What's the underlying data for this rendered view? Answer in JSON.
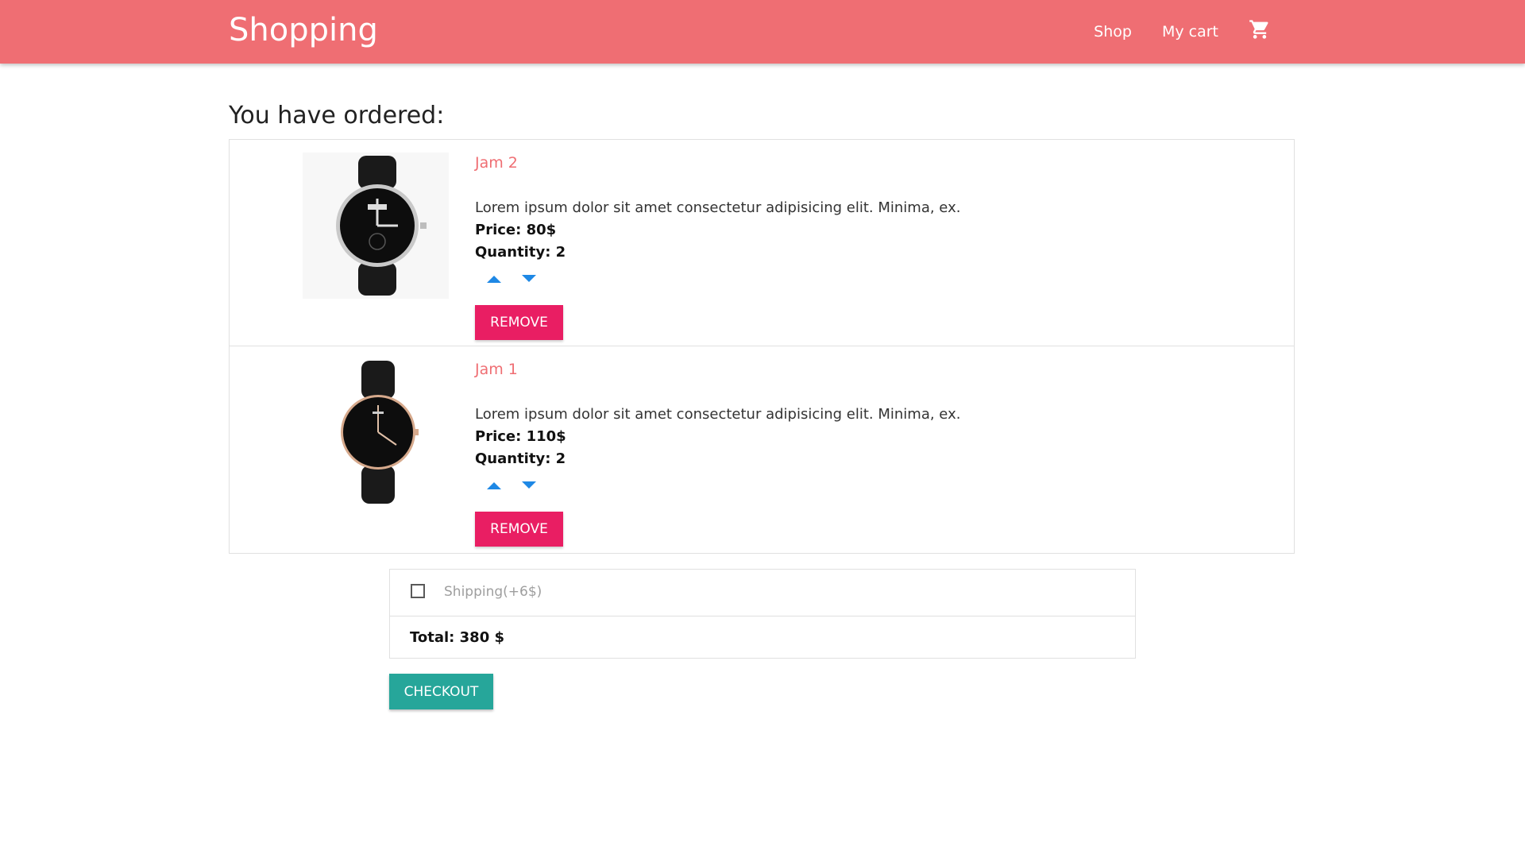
{
  "navbar": {
    "brand": "Shopping",
    "links": [
      "Shop",
      "My cart"
    ],
    "cart_icon": "shopping-cart-icon"
  },
  "heading": "You have ordered:",
  "items": [
    {
      "title": "Jam 2",
      "description": "Lorem ipsum dolor sit amet consectetur adipisicing elit. Minima, ex.",
      "price_text": "Price: 80$",
      "quantity_text": "Quantity: 2",
      "remove_label": "REMOVE",
      "image": "watch-icon"
    },
    {
      "title": "Jam 1",
      "description": "Lorem ipsum dolor sit amet consectetur adipisicing elit. Minima, ex.",
      "price_text": "Price: 110$",
      "quantity_text": "Quantity: 2",
      "remove_label": "REMOVE",
      "image": "watch-icon"
    }
  ],
  "summary": {
    "shipping_label": "Shipping(+6$)",
    "shipping_checked": false,
    "total_text": "Total: 380 $"
  },
  "checkout_label": "CHECKOUT",
  "colors": {
    "navbar": "#ef6e73",
    "title": "#ef6e73",
    "remove": "#e91e63",
    "checkout": "#26a69a",
    "arrow": "#1e88e5"
  }
}
